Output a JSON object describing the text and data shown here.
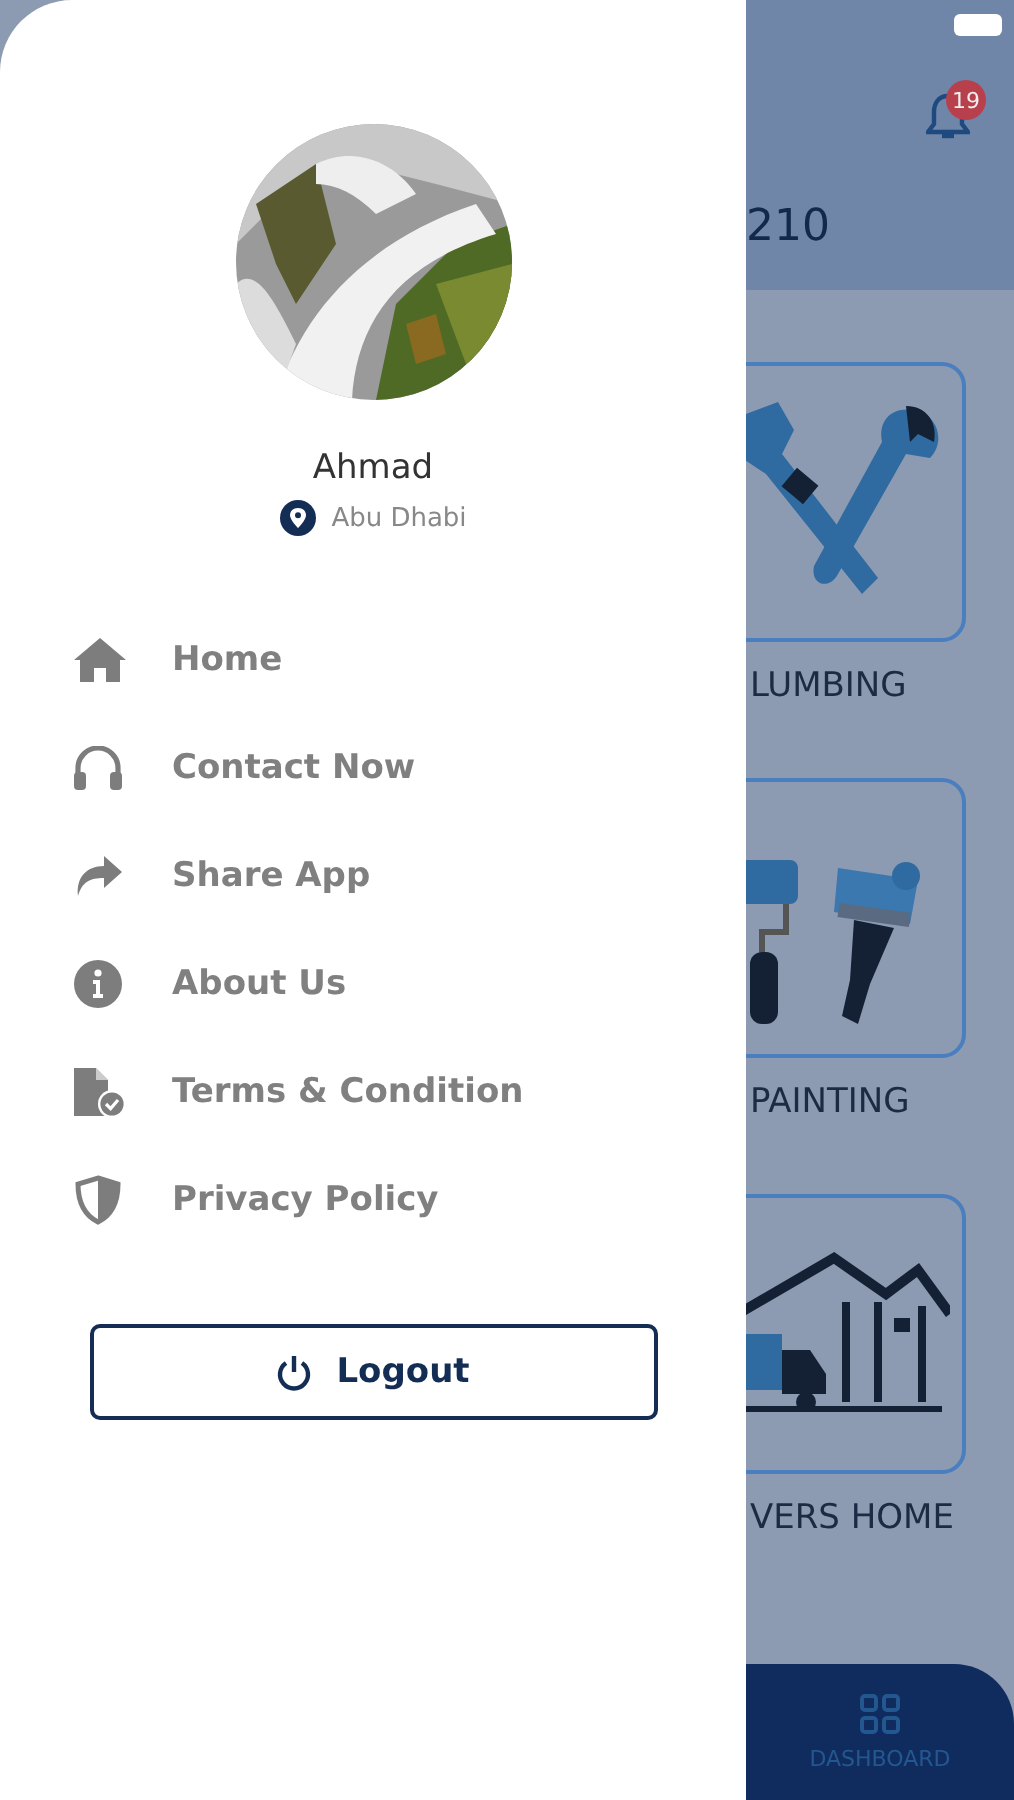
{
  "drawer": {
    "profile": {
      "name": "Ahmad",
      "location": "Abu Dhabi"
    },
    "menu": [
      {
        "kind": "home",
        "label": "Home"
      },
      {
        "kind": "headphones",
        "label": "Contact Now"
      },
      {
        "kind": "share",
        "label": "Share App"
      },
      {
        "kind": "info",
        "label": "About Us"
      },
      {
        "kind": "document",
        "label": "Terms & Condition"
      },
      {
        "kind": "shield",
        "label": "Privacy Policy"
      }
    ],
    "logout_button": "Logout"
  },
  "background": {
    "notification_badge": "19",
    "header_text": "210",
    "services": [
      {
        "kind": "plumbing",
        "label": "LUMBING"
      },
      {
        "kind": "painting",
        "label": "PAINTING"
      },
      {
        "kind": "movers",
        "label": "VERS HOME"
      }
    ],
    "bottom_nav": {
      "label": "DASHBOARD"
    }
  }
}
